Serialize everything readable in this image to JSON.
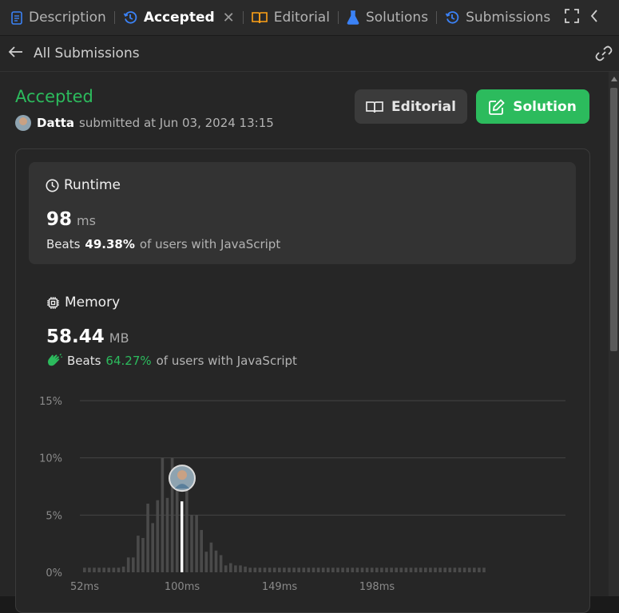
{
  "tabs": {
    "description": "Description",
    "accepted": "Accepted",
    "editorial": "Editorial",
    "solutions": "Solutions",
    "submissions": "Submissions"
  },
  "subheader": {
    "title": "All Submissions"
  },
  "submission": {
    "status": "Accepted",
    "username": "Datta",
    "submitted_text": "submitted at Jun 03, 2024 13:15"
  },
  "buttons": {
    "editorial": "Editorial",
    "solution": "Solution"
  },
  "runtime": {
    "label": "Runtime",
    "value": "98",
    "unit": "ms",
    "beats_word": "Beats",
    "beats_pct": "49.38%",
    "beats_suffix": "of users with JavaScript"
  },
  "memory": {
    "label": "Memory",
    "value": "58.44",
    "unit": "MB",
    "beats_word": "Beats",
    "beats_pct": "64.27%",
    "beats_suffix": "of users with JavaScript"
  },
  "colors": {
    "accent_green": "#2cbb5d",
    "tab_blue": "#3b82f6",
    "editorial_orange": "#ffa116"
  },
  "chart_data": {
    "type": "bar",
    "title": "",
    "xlabel": "",
    "ylabel": "",
    "ylim": [
      0,
      15
    ],
    "yticks": [
      "15%",
      "10%",
      "5%",
      "0%"
    ],
    "ytick_values": [
      15,
      10,
      5,
      0
    ],
    "xticks": [
      "52ms",
      "100ms",
      "149ms",
      "198ms"
    ],
    "xtick_indices": [
      0,
      20,
      40,
      60
    ],
    "values": [
      0.4,
      0.4,
      0.4,
      0.4,
      0.4,
      0.4,
      0.4,
      0.4,
      0.5,
      1.3,
      1.3,
      3.2,
      3.0,
      6.0,
      4.3,
      6.3,
      10.0,
      6.5,
      10.0,
      9.2,
      6.2,
      8.3,
      5.0,
      5.0,
      3.7,
      1.8,
      2.6,
      1.9,
      1.5,
      0.6,
      0.8,
      0.6,
      0.6,
      0.5,
      0.4,
      0.4,
      0.4,
      0.4,
      0.4,
      0.4,
      0.4,
      0.4,
      0.4,
      0.4,
      0.4,
      0.4,
      0.4,
      0.4,
      0.4,
      0.4,
      0.4,
      0.4,
      0.4,
      0.4,
      0.4,
      0.4,
      0.4,
      0.4,
      0.4,
      0.4,
      0.4,
      0.4,
      0.4,
      0.4,
      0.4,
      0.4,
      0.4,
      0.4,
      0.4,
      0.4,
      0.4,
      0.4,
      0.4,
      0.4,
      0.4,
      0.4,
      0.4,
      0.4,
      0.4,
      0.4,
      0.4,
      0.4,
      0.4
    ],
    "highlight_index": 20,
    "grid": true
  }
}
